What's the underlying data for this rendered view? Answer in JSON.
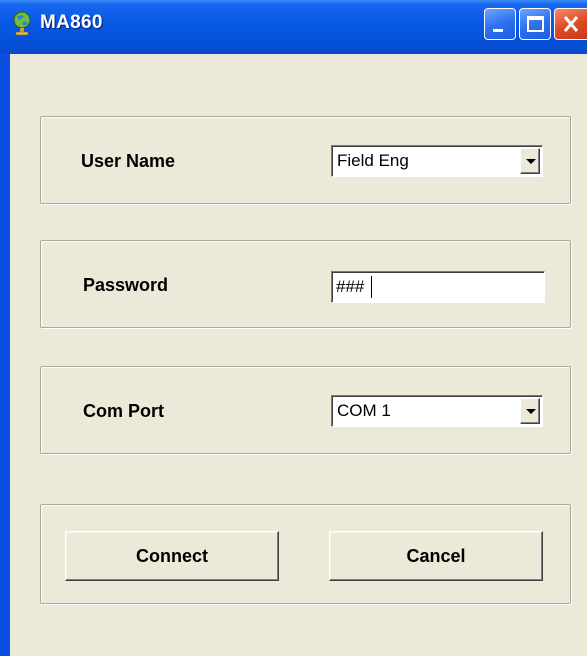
{
  "window": {
    "title": "MA860",
    "controls": {
      "minimize": "minimize-icon",
      "maximize": "maximize-icon",
      "close": "close-icon"
    },
    "app_icon": "globe-icon"
  },
  "form": {
    "user_name": {
      "label": "User Name",
      "value": "Field Eng"
    },
    "password": {
      "label": "Password",
      "value": "###"
    },
    "com_port": {
      "label": "Com Port",
      "value": "COM 1"
    }
  },
  "buttons": {
    "connect": "Connect",
    "cancel": "Cancel"
  },
  "colors": {
    "title_bar": "#0858e6",
    "dialog_bg": "#ece9d8",
    "close_button": "#de4a23"
  }
}
